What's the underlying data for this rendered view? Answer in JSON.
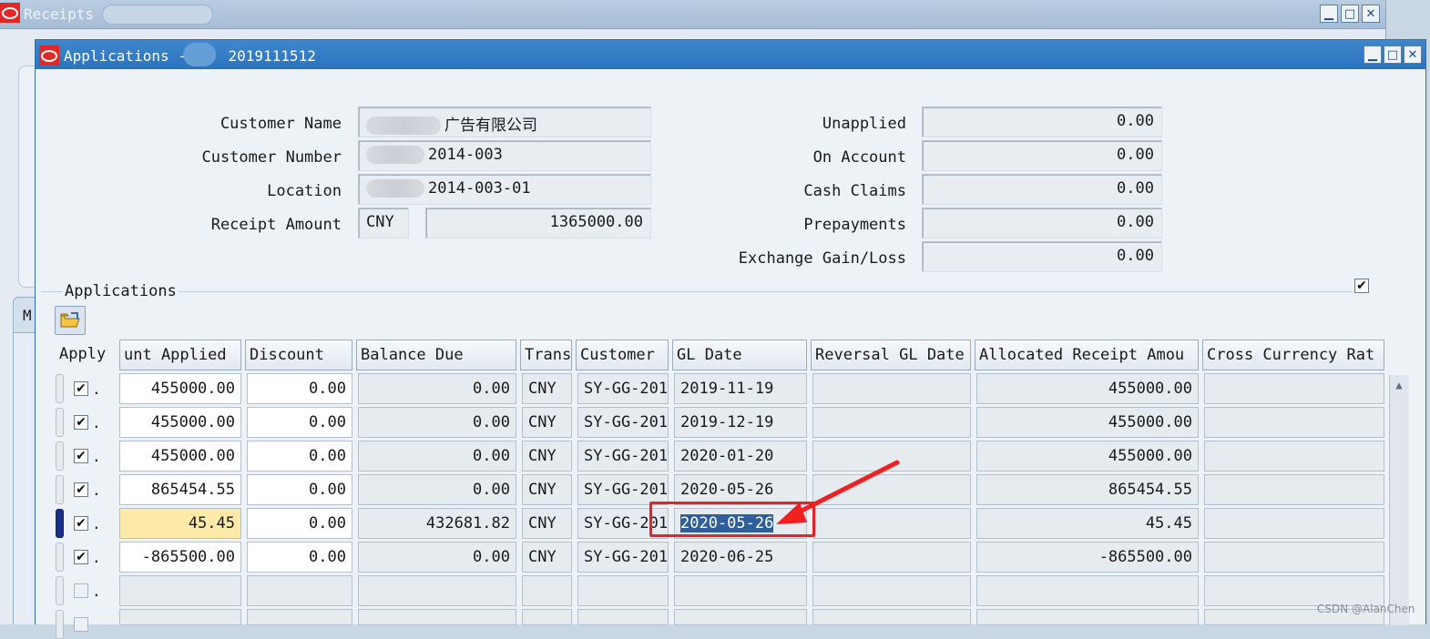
{
  "back_window": {
    "title": "Receipts",
    "tab_initial": "M"
  },
  "window": {
    "title": "Applications - ",
    "title_suffix": "2019111512"
  },
  "window_controls": {
    "minimize": "▁",
    "maximize": "□",
    "close": "✕"
  },
  "header_fields": {
    "customer_name": {
      "label": "Customer Name",
      "value": "广告有限公司"
    },
    "customer_number": {
      "label": "Customer Number",
      "value": "2014-003"
    },
    "location": {
      "label": "Location",
      "value": "2014-003-01"
    },
    "receipt_amount": {
      "label": "Receipt Amount",
      "currency": "CNY",
      "value": "1365000.00"
    }
  },
  "totals": {
    "unapplied": {
      "label": "Unapplied",
      "value": "0.00"
    },
    "on_account": {
      "label": "On Account",
      "value": "0.00"
    },
    "cash_claims": {
      "label": "Cash Claims",
      "value": "0.00"
    },
    "prepayments": {
      "label": "Prepayments",
      "value": "0.00"
    },
    "exchange_gain_loss": {
      "label": "Exchange Gain/Loss",
      "value": "0.00"
    }
  },
  "applications": {
    "section_label": "Applications",
    "columns": [
      "Apply",
      "unt Applied",
      "Discount",
      "Balance Due",
      "Trans",
      "Customer",
      "GL Date",
      "Reversal GL Date",
      "Allocated Receipt Amou",
      "Cross Currency Rat"
    ],
    "rows": [
      {
        "applied": true,
        "dot": ".",
        "amount_applied": "455000.00",
        "discount": "0.00",
        "balance_due": "0.00",
        "trans": "CNY",
        "customer": "SY-GG-201",
        "gl_date": "2019-11-19",
        "allocated": "455000.00"
      },
      {
        "applied": true,
        "dot": ".",
        "amount_applied": "455000.00",
        "discount": "0.00",
        "balance_due": "0.00",
        "trans": "CNY",
        "customer": "SY-GG-201",
        "gl_date": "2019-12-19",
        "allocated": "455000.00"
      },
      {
        "applied": true,
        "dot": ".",
        "amount_applied": "455000.00",
        "discount": "0.00",
        "balance_due": "0.00",
        "trans": "CNY",
        "customer": "SY-GG-201",
        "gl_date": "2020-01-20",
        "allocated": "455000.00"
      },
      {
        "applied": true,
        "dot": ".",
        "amount_applied": "865454.55",
        "discount": "0.00",
        "balance_due": "0.00",
        "trans": "CNY",
        "customer": "SY-GG-201",
        "gl_date": "2020-05-26",
        "allocated": "865454.55"
      },
      {
        "applied": true,
        "dot": ".",
        "amount_applied": "45.45",
        "discount": "0.00",
        "balance_due": "432681.82",
        "trans": "CNY",
        "customer": "SY-GG-201",
        "gl_date": "2020-05-26",
        "allocated": "45.45"
      },
      {
        "applied": true,
        "dot": ".",
        "amount_applied": "-865500.00",
        "discount": "0.00",
        "balance_due": "0.00",
        "trans": "CNY",
        "customer": "SY-GG-201",
        "gl_date": "2020-06-25",
        "allocated": "-865500.00"
      },
      {
        "applied": false,
        "dot": ".",
        "amount_applied": "",
        "discount": "",
        "balance_due": "",
        "trans": "",
        "customer": "",
        "gl_date": "",
        "allocated": ""
      }
    ]
  },
  "checkmark": "✔",
  "watermark": "CSDN @AlanChen",
  "colors": {
    "titlebar": "#2a74bf",
    "highlight": "#f02020",
    "selected_text_bg": "#2e5f9a",
    "current_field": "#fde9a8"
  }
}
